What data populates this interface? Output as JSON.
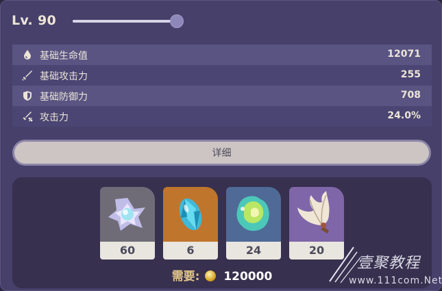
{
  "level": {
    "label": "Lv. 90",
    "slider_value_fraction": 1.0
  },
  "stats": [
    {
      "icon": "hp-drop-icon",
      "label": "基础生命值",
      "value": "12071"
    },
    {
      "icon": "sword-icon",
      "label": "基础攻击力",
      "value": "255"
    },
    {
      "icon": "shield-icon",
      "label": "基础防御力",
      "value": "708"
    },
    {
      "icon": "attack-up-icon",
      "label": "攻击力",
      "value": "24.0%"
    }
  ],
  "detail_button": {
    "label": "详细"
  },
  "materials": [
    {
      "icon": "crystal-flower-icon",
      "count": "60",
      "bg": "#6f6c78"
    },
    {
      "icon": "blue-gem-icon",
      "count": "6",
      "bg": "#c0752d"
    },
    {
      "icon": "green-chunk-icon",
      "count": "24",
      "bg": "#4f6a96"
    },
    {
      "icon": "feather-fan-icon",
      "count": "20",
      "bg": "#7e66a8"
    }
  ],
  "cost": {
    "label": "需要:",
    "value": "120000",
    "icon": "mora-coin-icon"
  },
  "watermark": {
    "title": "壹聚教程",
    "url": "www.111com.Net"
  }
}
